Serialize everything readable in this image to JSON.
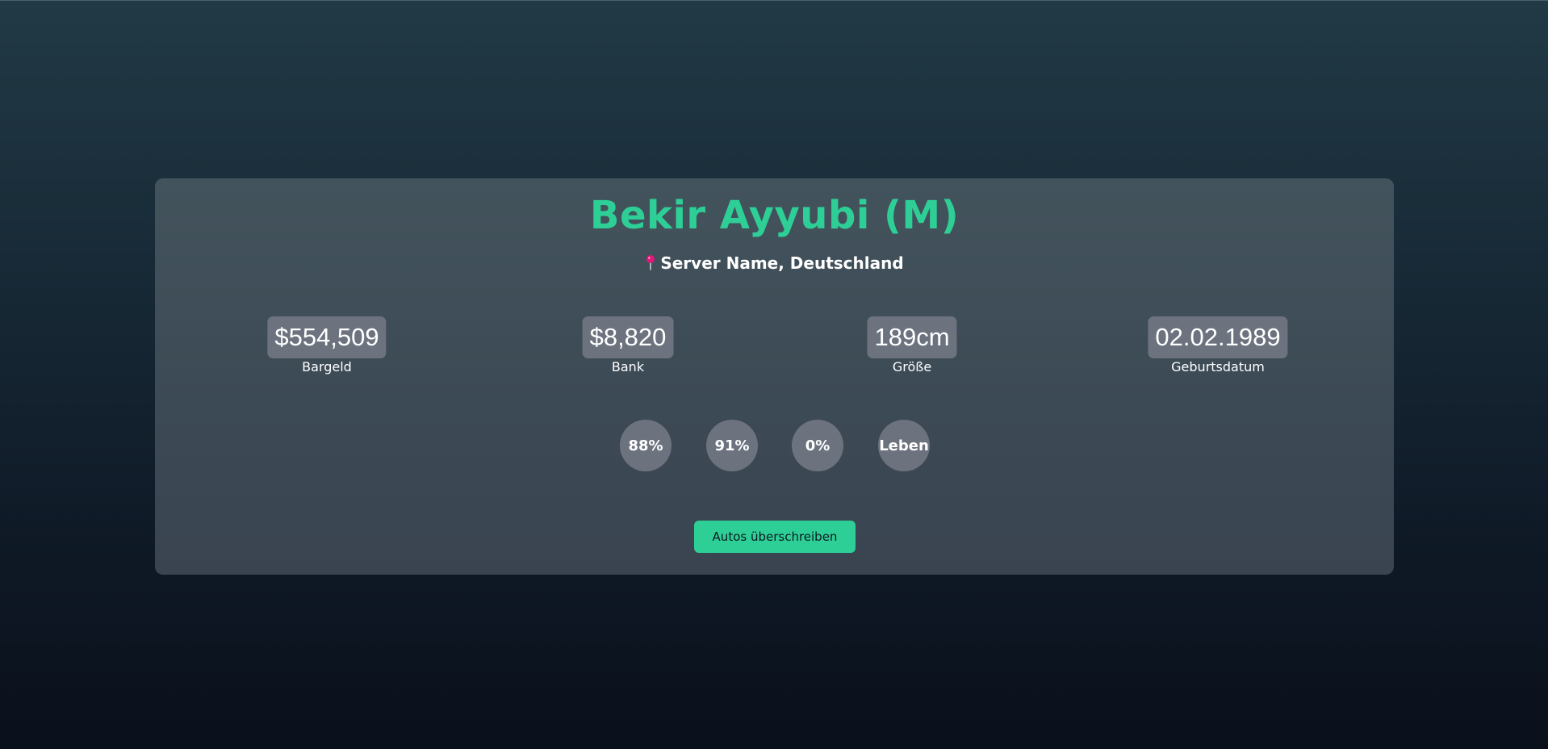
{
  "profile": {
    "name": "Bekir Ayyubi (M)",
    "location": "Server Name, Deutschland",
    "location_icon": "map-pin-icon"
  },
  "stats": {
    "cash": {
      "value": "$554,509",
      "label": "Bargeld"
    },
    "bank": {
      "value": "$8,820",
      "label": "Bank"
    },
    "height": {
      "value": "189cm",
      "label": "Größe"
    },
    "birthdate": {
      "value": "02.02.1989",
      "label": "Geburtsdatum"
    }
  },
  "status_circles": [
    "88%",
    "91%",
    "0%",
    "Leben"
  ],
  "actions": {
    "transfer_cars_label": "Autos überschreiben"
  },
  "colors": {
    "accent": "#2ecf96",
    "chip": "#6c737f",
    "pin": "#e0187a"
  }
}
